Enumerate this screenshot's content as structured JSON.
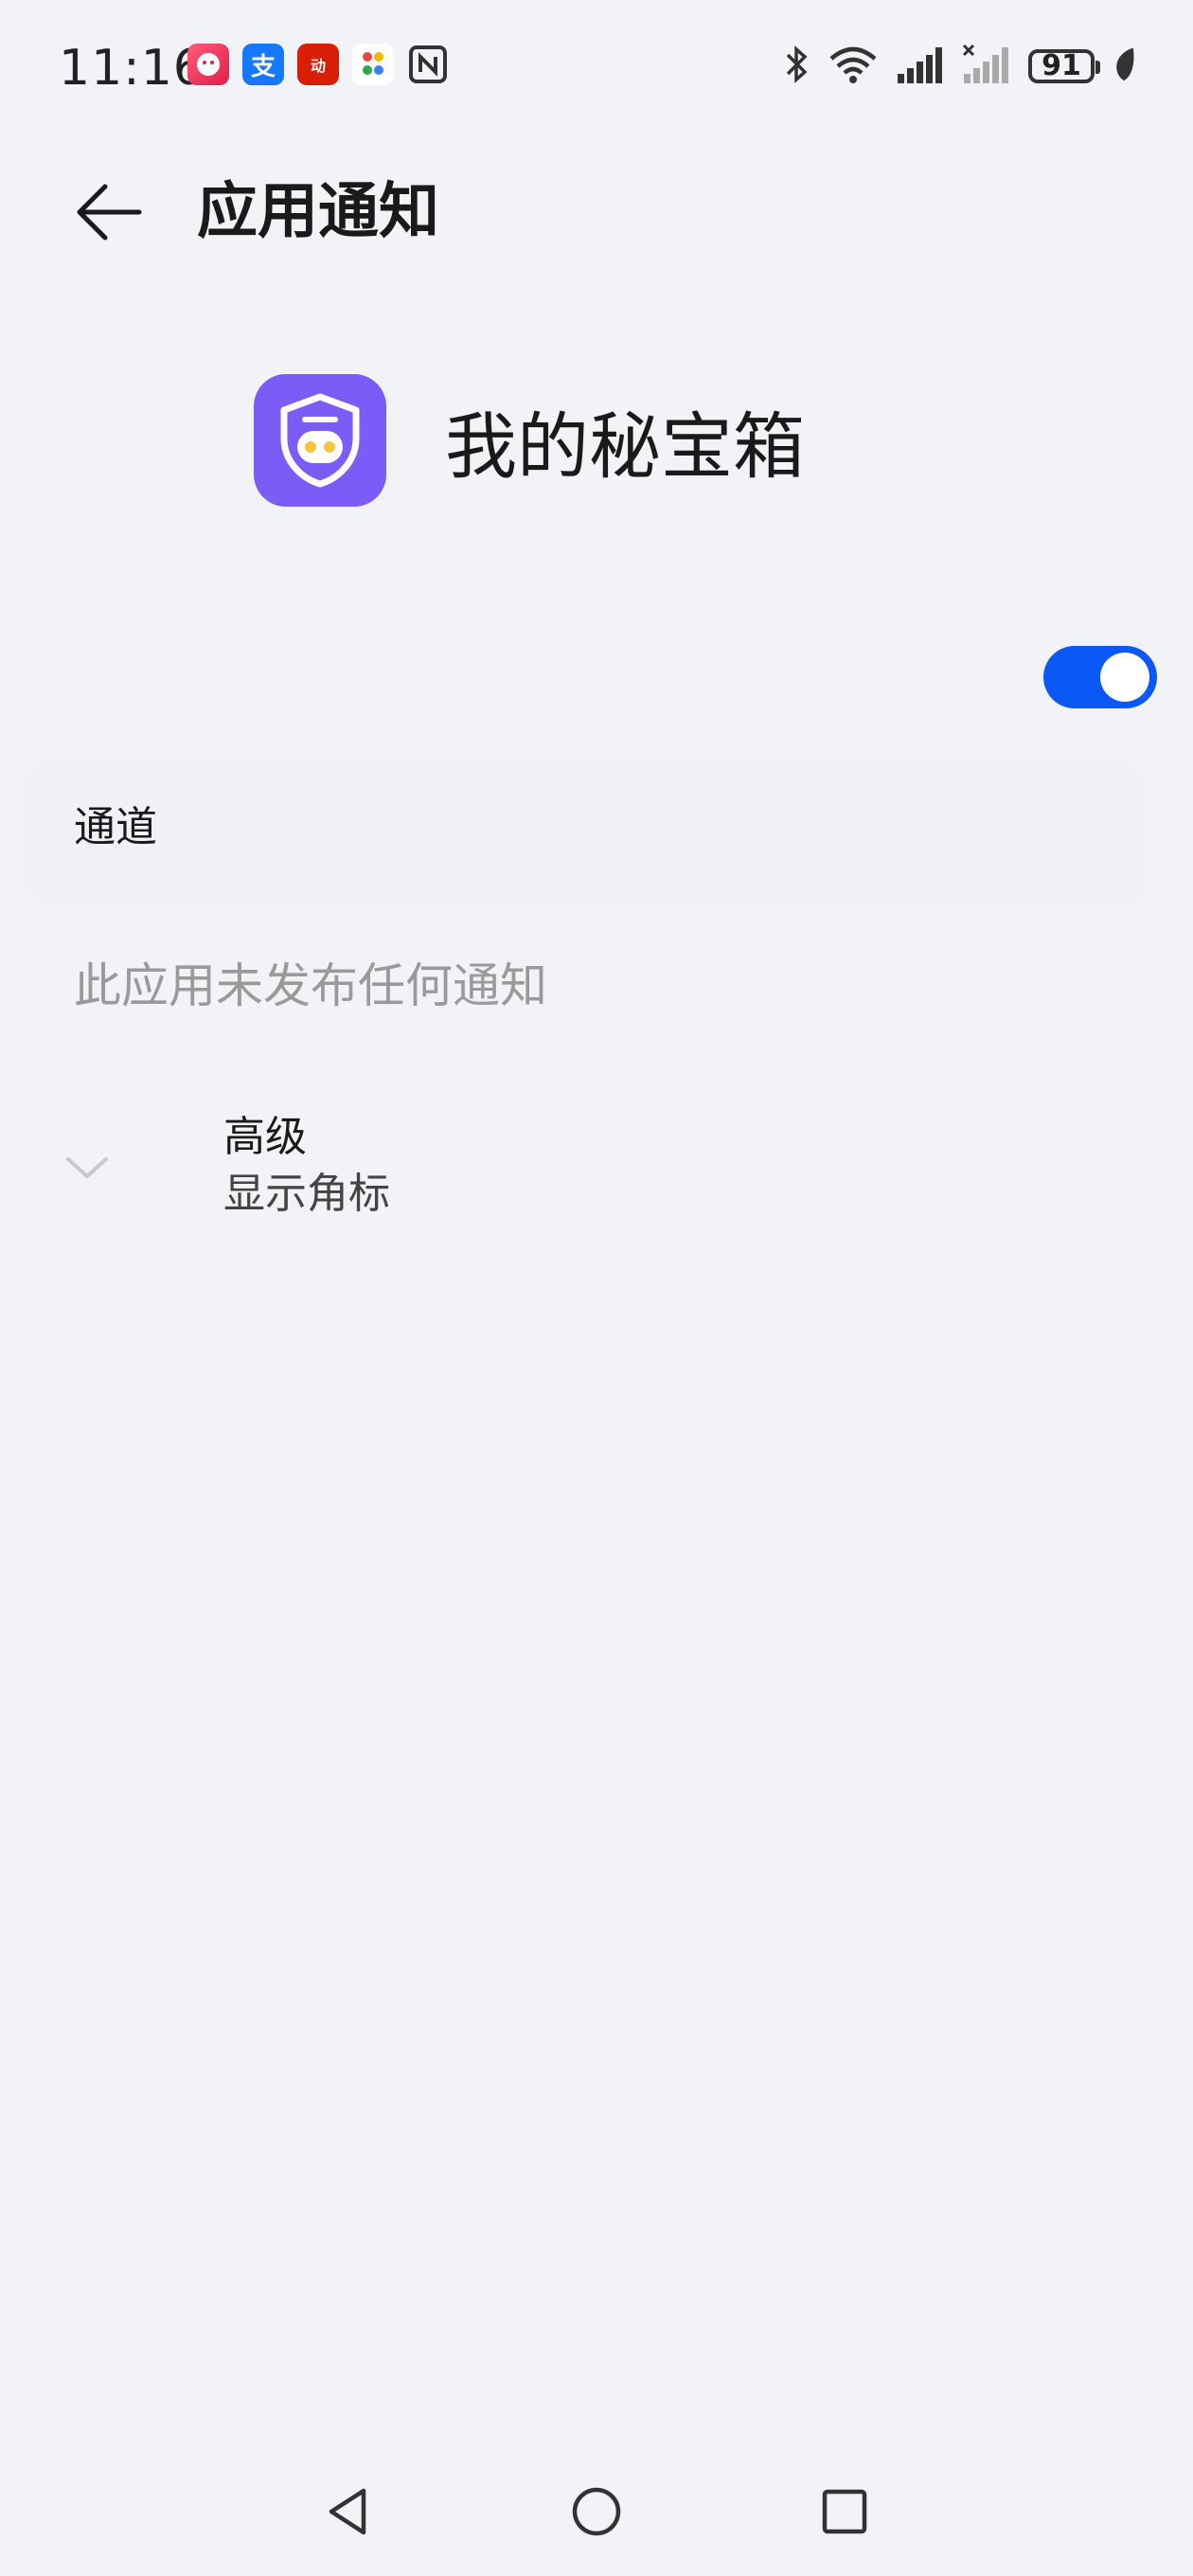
{
  "status_bar": {
    "time": "11:16",
    "notification_icons": [
      "app-icon",
      "alipay-icon",
      "app-icon",
      "app-icon",
      "nfc-icon"
    ],
    "alipay_glyph": "支",
    "app3_glyph": "动",
    "battery_level": "91",
    "indicators": [
      "bluetooth-icon",
      "wifi-icon",
      "signal-icon",
      "signal-no-service-icon",
      "battery-icon",
      "power-saving-leaf-icon"
    ]
  },
  "header": {
    "title": "应用通知"
  },
  "app": {
    "name": "我的秘宝箱",
    "icon_color": "#7b5cf7"
  },
  "main_toggle": {
    "on": true,
    "color": "#0a59f7"
  },
  "channels": {
    "title": "通道",
    "empty_message": "此应用未发布任何通知"
  },
  "advanced": {
    "title": "高级",
    "subtitle": "显示角标"
  },
  "nav_bar": {
    "buttons": [
      "back-triangle-icon",
      "home-circle-icon",
      "recent-square-icon"
    ]
  }
}
